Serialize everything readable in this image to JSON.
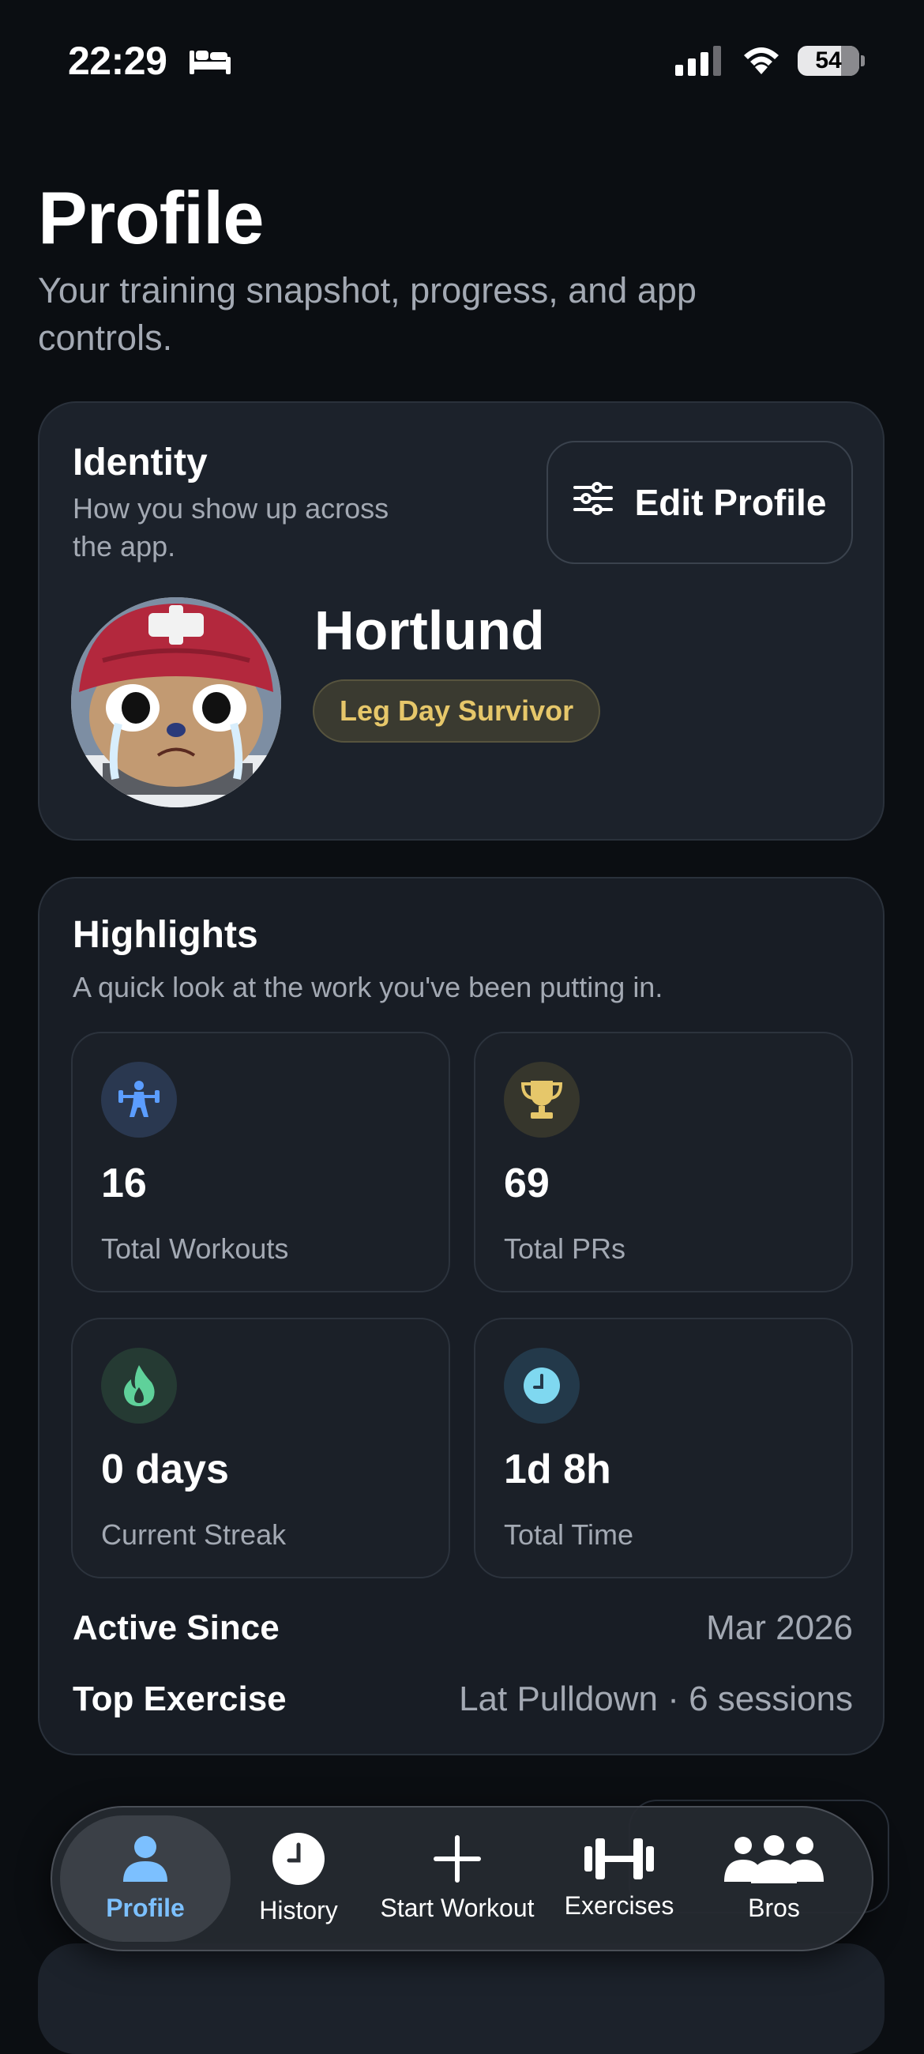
{
  "status_bar": {
    "time": "22:29",
    "battery": "54"
  },
  "header": {
    "title": "Profile",
    "subtitle": "Your training snapshot, progress, and app controls."
  },
  "identity": {
    "title": "Identity",
    "description": "How you show up across the app.",
    "edit_button": "Edit Profile",
    "username": "Hortlund",
    "badge": "Leg Day Survivor"
  },
  "highlights": {
    "title": "Highlights",
    "description": "A quick look at the work you've been putting in.",
    "stats": [
      {
        "value": "16",
        "label": "Total Workouts",
        "icon": "weightlifter-icon",
        "color": "#5b9dff"
      },
      {
        "value": "69",
        "label": "Total PRs",
        "icon": "trophy-icon",
        "color": "#e6c76a"
      },
      {
        "value": "0 days",
        "label": "Current Streak",
        "icon": "flame-icon",
        "color": "#5fd19a"
      },
      {
        "value": "1d 8h",
        "label": "Total Time",
        "icon": "clock-icon",
        "color": "#7fd8f0"
      }
    ],
    "active_since": {
      "label": "Active Since",
      "value": "Mar 2026"
    },
    "top_exercise": {
      "label": "Top Exercise",
      "value": "Lat Pulldown · 6 sessions"
    }
  },
  "tabbar": {
    "tabs": [
      {
        "label": "Profile",
        "icon": "person-icon"
      },
      {
        "label": "History",
        "icon": "clock-icon"
      },
      {
        "label": "Start Workout",
        "icon": "plus-icon"
      },
      {
        "label": "Exercises",
        "icon": "dumbbell-icon"
      },
      {
        "label": "Bros",
        "icon": "group-icon"
      }
    ],
    "active": "Profile"
  },
  "colors": {
    "background": "#0b0e12",
    "card": "#1c222b",
    "accent": "#7cc0ff",
    "gold": "#e6c76a"
  }
}
